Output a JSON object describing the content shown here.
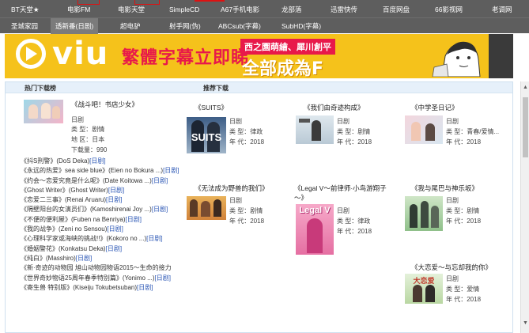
{
  "nav_row1": [
    "BT天堂★",
    "电影FM",
    "电影天堂",
    "SimpleCD",
    "A67手机电影",
    "龙部落",
    "迅雷快传",
    "百度网盘",
    "66影视网",
    "老调网"
  ],
  "nav_row2": [
    "圣城家园",
    "透新番(日剧)",
    "超电驴",
    "射手网(伪)",
    "ABCsub(字幕)",
    "SubHD(字幕)"
  ],
  "banner": {
    "brand": "viu",
    "slogan": "繁體字幕立即睇",
    "tag": "西之園萌繪、犀川創平",
    "headline": "全部成為F"
  },
  "sections": {
    "hot": "热门下载榜",
    "recommended": "推荐下载"
  },
  "featured": {
    "title": "《战斗吧！书店少女》",
    "genre_line": "日剧",
    "type_label": "类  型：剧情",
    "region_label": "地  区：日本",
    "downloads_label": "下载量：990"
  },
  "hot_list": [
    {
      "name": "《抖S刑警》(DoS Deka)",
      "tag": "[日剧]"
    },
    {
      "name": "《永远的热爱》sea side blue》(Eien no Bokura ...)",
      "tag": "[日剧]"
    },
    {
      "name": "《约会～恋爱究竟是什么呢》(Date Koitowa ...)",
      "tag": "[日剧]"
    },
    {
      "name": "《Ghost Writer》(Ghost Writer)",
      "tag": "[日剧]"
    },
    {
      "name": "《恋爱二三事》(Renai Aruaru)",
      "tag": "[日剧]"
    },
    {
      "name": "《隔壁阳台的女演员们》(Kamoshirenai Joy ...)",
      "tag": "[日剧]"
    },
    {
      "name": "《不便的便利屋》(Fuben na Benriya)",
      "tag": "[日剧]"
    },
    {
      "name": "《我的战争》(Zeni no Sensou)",
      "tag": "[日剧]"
    },
    {
      "name": "《心理科学家或海峡的挑战!!》(Kokoro no ...)",
      "tag": "[日剧]"
    },
    {
      "name": "《婚姻警花》(Konkatsu Deka)",
      "tag": "[日剧]"
    },
    {
      "name": "《纯白》(Masshiro)",
      "tag": "[日剧]"
    },
    {
      "name": "《新·奇迹的动物园 旭山动物园物语2015～生命的接力",
      "tag": ""
    },
    {
      "name": "《世界奇妙物语25周年春季特别篇》(Yonimo ...)",
      "tag": "[日剧]"
    },
    {
      "name": "《寄生兽 特别版》(Kiseiju Tokubetsuban)",
      "tag": "[日剧]"
    }
  ],
  "recommended": [
    {
      "title": "《SUITS》",
      "genre": "日剧",
      "type": "类  型：律政",
      "year": "年  代：2018",
      "poster_text": "SUITS"
    },
    {
      "title": "《我们由奇迹构成》",
      "genre": "日剧",
      "type": "类  型：剧情",
      "year": "年  代：2018",
      "poster_text": ""
    },
    {
      "title": "《中学圣日记》",
      "genre": "日剧",
      "type": "类  型：青春/爱情...",
      "year": "年  代：2018",
      "poster_text": ""
    },
    {
      "title": "《无法成为野兽的我们》",
      "genre": "日剧",
      "type": "类  型：剧情",
      "year": "年  代：2018",
      "poster_text": ""
    },
    {
      "title": "《Legal V～前律师·小鸟游翔子～》",
      "genre": "日剧",
      "type": "类  型：律政",
      "year": "年  代：2018",
      "poster_text": "Legal V"
    },
    {
      "title": "《我与尾巴与神乐坂》",
      "genre": "日剧",
      "type": "类  型：剧情",
      "year": "年  代：2018",
      "poster_text": ""
    },
    {
      "title": "《大恋爱～与忘却我的你》",
      "genre": "日剧",
      "type": "类  型：爱情",
      "year": "年  代：2018",
      "poster_text": "大恋爱"
    }
  ],
  "colors": {
    "nav_bg": "#5e5e5e",
    "banner_yellow": "#f5c21b",
    "banner_pink": "#e8194a",
    "link_blue": "#2a56b5",
    "panel_head": "#e6f0fa"
  }
}
